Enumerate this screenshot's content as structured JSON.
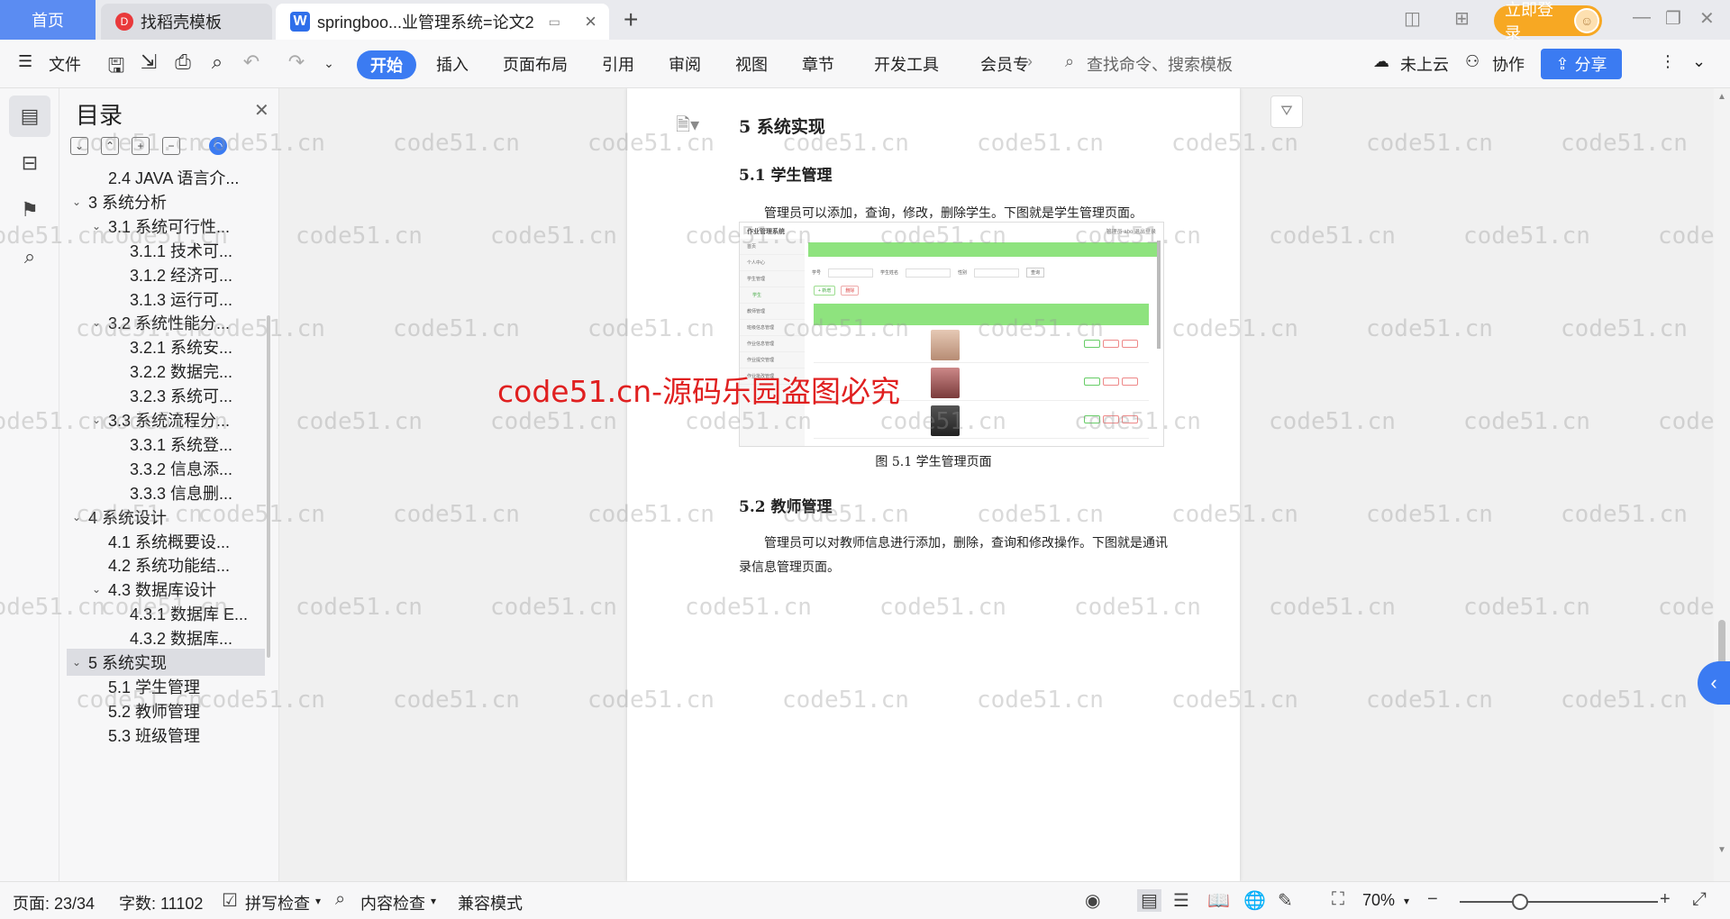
{
  "titlebar": {
    "home_tab": "首页",
    "docer_tab": "找稻壳模板",
    "doc_tab": "springboo...业管理系统=论文2",
    "login_button": "立即登录"
  },
  "ribbon": {
    "file": "文件",
    "tabs": [
      "开始",
      "插入",
      "页面布局",
      "引用",
      "审阅",
      "视图",
      "章节",
      "开发工具",
      "会员专"
    ],
    "search_placeholder": "查找命令、搜索模板",
    "cloud": "未上云",
    "collab": "协作",
    "share": "分享"
  },
  "toc": {
    "title": "目录",
    "items": [
      {
        "label": "2.4 JAVA 语言介...",
        "level": 2,
        "chev": ""
      },
      {
        "label": "3  系统分析",
        "level": 1,
        "chev": "v"
      },
      {
        "label": "3.1 系统可行性...",
        "level": 2,
        "chev": "v"
      },
      {
        "label": "3.1.1  技术可...",
        "level": 3,
        "chev": ""
      },
      {
        "label": "3.1.2  经济可...",
        "level": 3,
        "chev": ""
      },
      {
        "label": "3.1.3  运行可...",
        "level": 3,
        "chev": ""
      },
      {
        "label": "3.2 系统性能分...",
        "level": 2,
        "chev": "v"
      },
      {
        "label": "3.2.1  系统安...",
        "level": 3,
        "chev": ""
      },
      {
        "label": "3.2.2  数据完...",
        "level": 3,
        "chev": ""
      },
      {
        "label": "3.2.3  系统可...",
        "level": 3,
        "chev": ""
      },
      {
        "label": "3.3 系统流程分...",
        "level": 2,
        "chev": "v"
      },
      {
        "label": "3.3.1  系统登...",
        "level": 3,
        "chev": ""
      },
      {
        "label": "3.3.2  信息添...",
        "level": 3,
        "chev": ""
      },
      {
        "label": "3.3.3  信息删...",
        "level": 3,
        "chev": ""
      },
      {
        "label": "4  系统设计",
        "level": 1,
        "chev": "v"
      },
      {
        "label": "4.1 系统概要设...",
        "level": 2,
        "chev": ""
      },
      {
        "label": "4.2 系统功能结...",
        "level": 2,
        "chev": ""
      },
      {
        "label": "4.3 数据库设计",
        "level": 2,
        "chev": "v"
      },
      {
        "label": "4.3.1 数据库 E...",
        "level": 3,
        "chev": ""
      },
      {
        "label": "4.3.2  数据库...",
        "level": 3,
        "chev": ""
      },
      {
        "label": "5  系统实现",
        "level": 1,
        "chev": "v",
        "selected": true
      },
      {
        "label": "5.1  学生管理",
        "level": 2,
        "chev": ""
      },
      {
        "label": "5.2  教师管理",
        "level": 2,
        "chev": ""
      },
      {
        "label": "5.3  班级管理",
        "level": 2,
        "chev": ""
      }
    ]
  },
  "document": {
    "h1": "5  系统实现",
    "h2_1": "5.1  学生管理",
    "p1": "管理员可以添加，查询，修改，删除学生。下图就是学生管理页面。",
    "caption": "图 5.1  学生管理页面",
    "h2_2": "5.2  教师管理",
    "p2": "管理员可以对教师信息进行添加，删除，查询和修改操作。下图就是通讯录信息管理页面。",
    "screenshot": {
      "app_title": "作业管理系统",
      "user_text": "管理员 abo   退出登录",
      "menu": [
        "首页",
        "个人中心",
        "学生管理",
        "学生",
        "教师管理",
        "班级信息管理",
        "作业信息管理",
        "作业提交管理",
        "作业批改管理"
      ],
      "search_labels": [
        "学号",
        "学生姓名",
        "性别"
      ],
      "search_button": "查询",
      "add_button": "+ 新增",
      "delete_button": "删除"
    }
  },
  "watermark": {
    "text": "code51.cn",
    "red_text": "code51.cn-源码乐园盗图必究"
  },
  "status": {
    "page": "页面: 23/34",
    "words": "字数: 11102",
    "spell": "拼写检查",
    "content": "内容检查",
    "compat": "兼容模式",
    "zoom": "70%"
  }
}
